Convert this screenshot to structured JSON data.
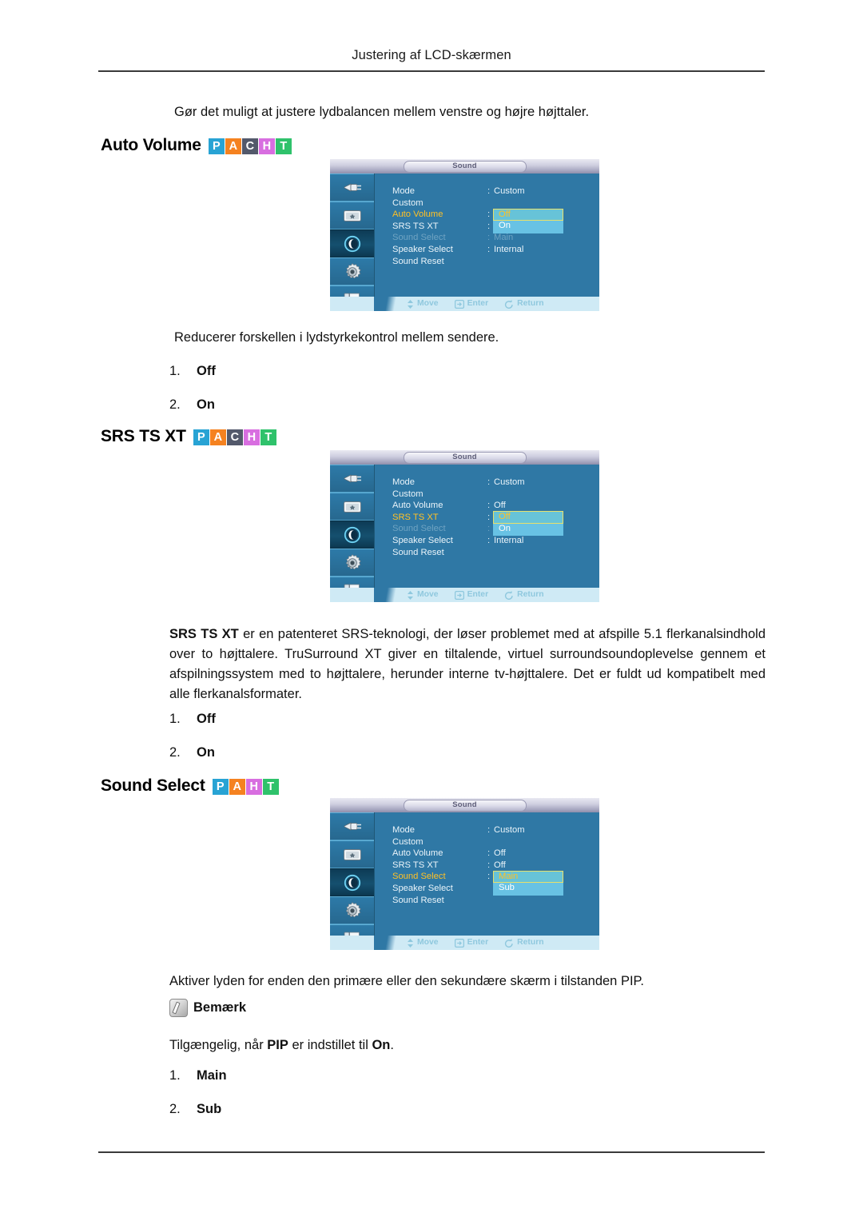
{
  "header": {
    "running_title": "Justering af LCD-skærmen"
  },
  "intro": {
    "text": "Gør det muligt at justere lydbalancen mellem venstre og højre højttaler."
  },
  "badge_letters": {
    "P": {
      "char": "P",
      "color": "#28a3d4"
    },
    "A": {
      "char": "A",
      "color": "#f58220"
    },
    "C": {
      "char": "C",
      "color": "#53596b"
    },
    "H": {
      "char": "H",
      "color": "#d86ee0"
    },
    "T": {
      "char": "T",
      "color": "#2fc26b"
    }
  },
  "sections": [
    {
      "id": "auto-volume",
      "title": "Auto Volume",
      "badges": [
        "P",
        "A",
        "C",
        "H",
        "T"
      ],
      "description": "Reducerer forskellen i lydstyrkekontrol mellem sendere.",
      "options": [
        {
          "num": "1.",
          "value": "Off"
        },
        {
          "num": "2.",
          "value": "On"
        }
      ]
    },
    {
      "id": "srs-ts-xt",
      "title": "SRS TS XT",
      "badges": [
        "P",
        "A",
        "C",
        "H",
        "T"
      ],
      "description_lead": "SRS TS XT",
      "description": " er en patenteret SRS-teknologi, der løser problemet med at afspille 5.1 flerkanalsindhold over to højttalere. TruSurround XT giver en tiltalende, virtuel surroundsoundoplevelse gennem et afspilningssystem med to højttalere, herunder interne tv-højttalere. Det er fuldt ud kompatibelt med alle flerkanalsformater.",
      "options": [
        {
          "num": "1.",
          "value": "Off"
        },
        {
          "num": "2.",
          "value": "On"
        }
      ]
    },
    {
      "id": "sound-select",
      "title": "Sound Select",
      "badges": [
        "P",
        "A",
        "H",
        "T"
      ],
      "description": "Aktiver lyden for enden den primære eller den sekundære skærm i tilstanden PIP.",
      "note_label": "Bemærk",
      "note_text_1": "Tilgængelig, når ",
      "note_text_pip": "PIP",
      "note_text_2": " er indstillet til ",
      "note_text_on": "On",
      "note_text_3": ".",
      "options": [
        {
          "num": "1.",
          "value": "Main"
        },
        {
          "num": "2.",
          "value": "Sub"
        }
      ]
    }
  ],
  "osd": {
    "title": "Sound",
    "sidebar_icons": [
      "input-source-icon",
      "picture-icon",
      "sound-icon",
      "setup-gear-icon",
      "multi-control-icon"
    ],
    "selected_sidebar_index": 2,
    "footer": [
      {
        "icon": "updown-arrow-icon",
        "label": "Move"
      },
      {
        "icon": "enter-icon",
        "label": "Enter"
      },
      {
        "icon": "return-icon",
        "label": "Return"
      }
    ],
    "menus": [
      {
        "id": "osd-auto-volume",
        "rows": [
          {
            "label": "Mode",
            "colon": ":",
            "value": "Custom",
            "state": "normal"
          },
          {
            "label": "Custom",
            "colon": "",
            "value": "",
            "state": "normal"
          },
          {
            "label": "Auto Volume",
            "colon": ":",
            "value": "",
            "state": "active"
          },
          {
            "label": "SRS TS XT",
            "colon": ":",
            "value": "",
            "state": "normal"
          },
          {
            "label": "Sound Select",
            "colon": ":",
            "value": "Main",
            "state": "dim"
          },
          {
            "label": "Speaker Select",
            "colon": ":",
            "value": "Internal",
            "state": "normal"
          },
          {
            "label": "Sound Reset",
            "colon": "",
            "value": "",
            "state": "normal"
          }
        ],
        "popup": {
          "row_index": 2,
          "top": "Off",
          "bottom": "On"
        }
      },
      {
        "id": "osd-srs-ts-xt",
        "rows": [
          {
            "label": "Mode",
            "colon": ":",
            "value": "Custom",
            "state": "normal"
          },
          {
            "label": "Custom",
            "colon": "",
            "value": "",
            "state": "normal"
          },
          {
            "label": "Auto Volume",
            "colon": ":",
            "value": "Off",
            "state": "normal"
          },
          {
            "label": "SRS TS XT",
            "colon": ":",
            "value": "",
            "state": "active"
          },
          {
            "label": "Sound Select",
            "colon": ":",
            "value": "",
            "state": "dim"
          },
          {
            "label": "Speaker Select",
            "colon": ":",
            "value": "Internal",
            "state": "normal"
          },
          {
            "label": "Sound Reset",
            "colon": "",
            "value": "",
            "state": "normal"
          }
        ],
        "popup": {
          "row_index": 3,
          "top": "Off",
          "bottom": "On"
        }
      },
      {
        "id": "osd-sound-select",
        "rows": [
          {
            "label": "Mode",
            "colon": ":",
            "value": "Custom",
            "state": "normal"
          },
          {
            "label": "Custom",
            "colon": "",
            "value": "",
            "state": "normal"
          },
          {
            "label": "Auto Volume",
            "colon": ":",
            "value": "Off",
            "state": "normal"
          },
          {
            "label": "SRS TS XT",
            "colon": ":",
            "value": "Off",
            "state": "normal"
          },
          {
            "label": "Sound Select",
            "colon": ":",
            "value": "",
            "state": "active"
          },
          {
            "label": "Speaker Select",
            "colon": "",
            "value": "",
            "state": "normal"
          },
          {
            "label": "Sound Reset",
            "colon": "",
            "value": "",
            "state": "normal"
          }
        ],
        "popup": {
          "row_index": 4,
          "top": "Main",
          "bottom": "Sub"
        }
      }
    ]
  }
}
